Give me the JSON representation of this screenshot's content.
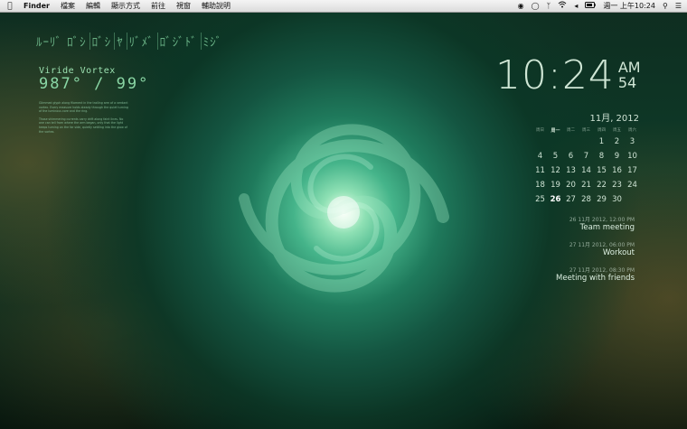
{
  "menubar": {
    "apple_icon": "apple-logo-icon",
    "items": [
      "Finder",
      "檔案",
      "編輯",
      "顯示方式",
      "前往",
      "視窗",
      "輔助說明"
    ],
    "clock": "週一 上午10:24",
    "tray_icons": [
      "adobe-updater-icon",
      "chat-bubble-icon",
      "bluetooth-icon",
      "wifi-icon",
      "volume-icon",
      "battery-icon",
      "search-icon",
      "list-icon"
    ]
  },
  "vortex_widget": {
    "glyphs": [
      "ﾙｰﾘﾞ ﾛﾞｼ",
      "ﾛﾞｼ",
      "ﾔ",
      "ﾘﾞﾒﾞ",
      "ﾛﾞｼﾞﾄﾞ",
      "ﾐｼﾞ"
    ],
    "title": "Viride Vortex",
    "reading": "987° / 99°",
    "paragraph_1": "Glimmed glyph along filament in the trailing arm of a verdant vortex. Every measure holds steady through the quiet turning of the luminous core and the ring.",
    "paragraph_2": "Those shimmering currents carry drift along faint lines. No one can tell from where the arm began, only that the light keeps turning on the far side, quietly settling into the glow of the vortex."
  },
  "clock": {
    "time": "10:24",
    "ampm": "AM",
    "seconds": "54"
  },
  "calendar": {
    "title": "11月, 2012",
    "weekdays": [
      "周日",
      "周一",
      "周二",
      "周三",
      "周四",
      "周五",
      "周六"
    ],
    "today_weekday_index": 1,
    "weeks": [
      [
        "",
        "",
        "",
        "",
        "1",
        "2",
        "3"
      ],
      [
        "4",
        "5",
        "6",
        "7",
        "8",
        "9",
        "10"
      ],
      [
        "11",
        "12",
        "13",
        "14",
        "15",
        "16",
        "17"
      ],
      [
        "18",
        "19",
        "20",
        "21",
        "22",
        "23",
        "24"
      ],
      [
        "25",
        "26",
        "27",
        "28",
        "29",
        "30",
        ""
      ]
    ],
    "today": "26"
  },
  "events": [
    {
      "time": "26 11月 2012, 12:00 PM",
      "title": "Team meeting"
    },
    {
      "time": "27 11月 2012, 06:00 PM",
      "title": "Workout"
    },
    {
      "time": "27 11月 2012, 08:30 PM",
      "title": "Meeting with friends"
    }
  ]
}
